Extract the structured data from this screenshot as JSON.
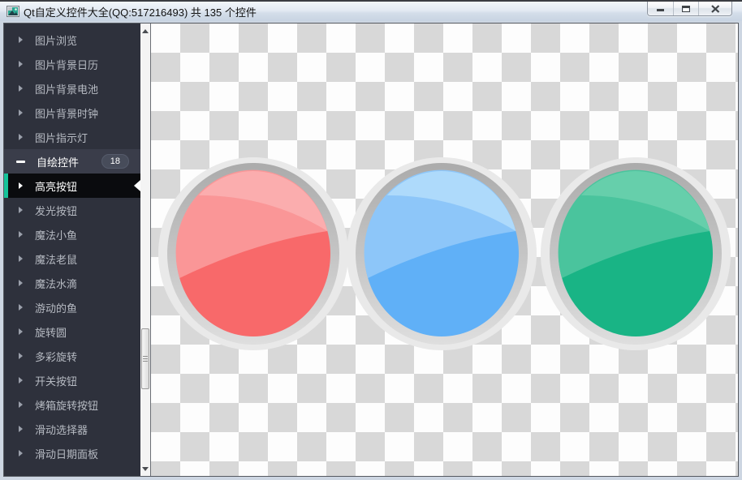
{
  "window": {
    "title": "Qt自定义控件大全(QQ:517216493) 共 135 个控件",
    "controls": {
      "minimize": "minimize",
      "maximize": "maximize",
      "close": "close"
    }
  },
  "sidebar": {
    "items": [
      {
        "label": "图片浏览",
        "state": "collapsed"
      },
      {
        "label": "图片背景日历",
        "state": "collapsed"
      },
      {
        "label": "图片背景电池",
        "state": "collapsed"
      },
      {
        "label": "图片背景时钟",
        "state": "collapsed"
      },
      {
        "label": "图片指示灯",
        "state": "collapsed"
      },
      {
        "label": "自绘控件",
        "state": "expanded",
        "badge": "18"
      },
      {
        "label": "高亮按钮",
        "state": "selected"
      },
      {
        "label": "发光按钮",
        "state": "collapsed"
      },
      {
        "label": "魔法小鱼",
        "state": "collapsed"
      },
      {
        "label": "魔法老鼠",
        "state": "collapsed"
      },
      {
        "label": "魔法水滴",
        "state": "collapsed"
      },
      {
        "label": "游动的鱼",
        "state": "collapsed"
      },
      {
        "label": "旋转圆",
        "state": "collapsed"
      },
      {
        "label": "多彩旋转",
        "state": "collapsed"
      },
      {
        "label": "开关按钮",
        "state": "collapsed"
      },
      {
        "label": "烤箱旋转按钮",
        "state": "collapsed"
      },
      {
        "label": "滑动选择器",
        "state": "collapsed"
      },
      {
        "label": "滑动日期面板",
        "state": "collapsed"
      }
    ],
    "colors": {
      "bg": "#2e313c",
      "expanded_bg": "#3a3d4a",
      "selected_bg": "#0a0b0e",
      "accent": "#15c39a",
      "badge_bg": "#474c5a",
      "text": "#b6bac2",
      "text_active": "#ffffff"
    }
  },
  "content": {
    "buttons": [
      {
        "name": "red-highlight-button",
        "body": "#f8696a",
        "light": "#fa9697",
        "streak": "#fbadae"
      },
      {
        "name": "blue-highlight-button",
        "body": "#60b0f7",
        "light": "#8dc6f9",
        "streak": "#aedafb"
      },
      {
        "name": "green-highlight-button",
        "body": "#19b485",
        "light": "#4ac49d",
        "streak": "#66cfab"
      }
    ],
    "ring": {
      "halo": "#e9e9e9",
      "top": "#ababab",
      "bottom": "#dedede"
    },
    "checker": {
      "light": "#fdfdfd",
      "dark": "#d8d8d8"
    }
  }
}
